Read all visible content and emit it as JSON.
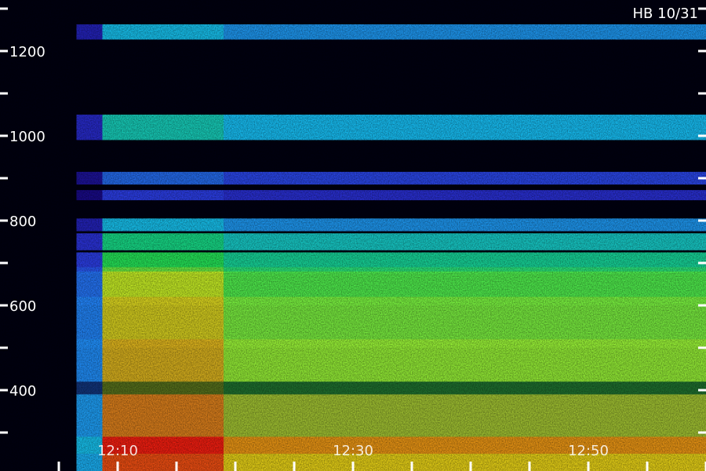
{
  "chart_data": {
    "type": "heatmap",
    "annotation": "HB 10/31",
    "colormap": [
      "#000010",
      "#1a0a8c",
      "#2f3cf0",
      "#18c8ff",
      "#18f060",
      "#f0f018",
      "#ff2010"
    ],
    "y_axis": {
      "tick_labels": [
        "1200",
        "1000",
        "800",
        "600",
        "400"
      ],
      "tick_values": [
        1200,
        1000,
        800,
        600,
        400
      ],
      "minor_ticks": [
        1300,
        1100,
        900,
        700,
        500,
        300
      ],
      "range": [
        250,
        1300
      ]
    },
    "x_axis": {
      "tick_labels": [
        "12:10",
        "12:30",
        "12:50"
      ],
      "range": [
        "12:05",
        "12:65"
      ]
    },
    "segments": [
      {
        "start": 6.5,
        "end": 8.7,
        "level": 0.35
      },
      {
        "start": 8.7,
        "end": 19.0,
        "level": 0.7
      },
      {
        "start": 19.0,
        "end": 60,
        "level": 0.62
      }
    ],
    "bands": [
      {
        "center": 1245,
        "width": 18,
        "intensity": 0.45
      },
      {
        "center": 1020,
        "width": 30,
        "intensity": 0.5
      },
      {
        "center": 900,
        "width": 15,
        "intensity": 0.35
      },
      {
        "center": 860,
        "width": 12,
        "intensity": 0.3
      },
      {
        "center": 790,
        "width": 15,
        "intensity": 0.45
      },
      {
        "center": 750,
        "width": 20,
        "intensity": 0.55
      },
      {
        "center": 700,
        "width": 25,
        "intensity": 0.6
      },
      {
        "center": 640,
        "width": 40,
        "intensity": 0.72
      },
      {
        "center": 560,
        "width": 60,
        "intensity": 0.78
      },
      {
        "center": 470,
        "width": 50,
        "intensity": 0.82
      },
      {
        "center": 320,
        "width": 70,
        "intensity": 0.9
      }
    ]
  }
}
